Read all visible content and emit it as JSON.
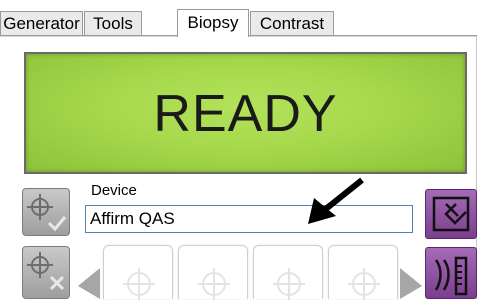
{
  "tabs": [
    {
      "label": "Generator",
      "active": false
    },
    {
      "label": "Tools",
      "active": false
    },
    {
      "label": "Biopsy",
      "active": true
    },
    {
      "label": "Contrast",
      "active": false
    }
  ],
  "status": {
    "text": "READY",
    "color": "#a6d84c"
  },
  "device": {
    "label": "Device",
    "value": "Affirm QAS"
  },
  "left_buttons": [
    {
      "icon": "target-check-icon"
    },
    {
      "icon": "target-delete-icon"
    }
  ],
  "right_buttons": [
    {
      "icon": "swap-view-icon"
    },
    {
      "icon": "needle-gauge-icon"
    }
  ],
  "thumbnails": [
    {
      "icon": "crosshair-icon"
    },
    {
      "icon": "crosshair-icon"
    },
    {
      "icon": "crosshair-icon"
    },
    {
      "icon": "crosshair-icon"
    }
  ],
  "colors": {
    "accent_purple": "#8b4a9f",
    "input_border": "#4f81bd"
  }
}
